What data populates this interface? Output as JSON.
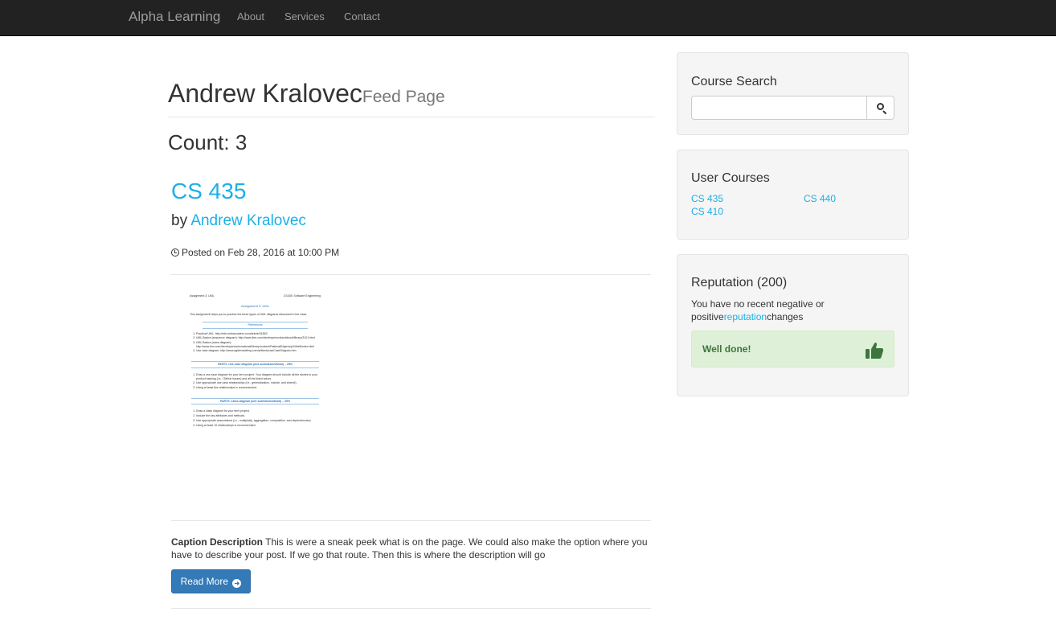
{
  "navbar": {
    "brand": "Alpha Learning",
    "links": [
      "About",
      "Services",
      "Contact"
    ]
  },
  "page": {
    "title": "Andrew Kralovec",
    "subtitle": "Feed Page",
    "count_label": "Count: 3"
  },
  "post": {
    "title": "CS 435",
    "by_label": "by",
    "author": "Andrew Kralovec",
    "posted": "Posted on Feb 28, 2016 at 10:00 PM",
    "caption_label": "Caption Description",
    "caption_text": "This is were a sneak peek what is on the page. We could also make the option where you have to describe your post. If we go that route. Then this is where the description will go",
    "read_more": "Read More"
  },
  "document": {
    "header_left": "Assignment 3: UML",
    "header_right": "CS435: Software Engineering",
    "title": "Assignment 3: UML",
    "intro": "This assignment helps you to practice the three types of UML diagrams discussed in the class.",
    "references_heading": "References",
    "references": [
      "Practical UML: http://edn.embarcadero.com/article/31863",
      "UML Basics (sequence diagram): http://www.ibm.com/developerworks/rational/library/3101.html",
      "UML Basics (class diagram): http://www.ibm.com/developerworks/rational/library/content/RationalEdge/sep04/bell/index.html",
      "Use case diagram: http://www.agilemodeling.com/artifacts/useCaseDiagram.htm"
    ],
    "part1_heading": "PART1: Use case diagram (one submission/team) – 25%",
    "part1_items": [
      "Draw a use case diagram for your term project. Your diagram should include all the stories in your product backlog (i.e., GitHub issues) and all the listed actors.",
      "Use appropriate use case relationships (i.e., generalization, include, and extend).",
      "Using at least five relationships is recommended."
    ],
    "part2_heading": "PART2: Class diagram (one submission/team) – 25%",
    "part2_items": [
      "Draw a class diagram for your term project.",
      "Include the key attributes and methods.",
      "Use appropriate associations (i.e., multiplicity, aggregation, composition, and dependencies).",
      "Using at least 10 relationships is recommended."
    ]
  },
  "sidebar": {
    "search": {
      "heading": "Course Search",
      "placeholder": ""
    },
    "courses": {
      "heading": "User Courses",
      "items": [
        "CS 435",
        "CS 440",
        "CS 410"
      ]
    },
    "reputation": {
      "heading": "Reputation (200)",
      "text_before": "You have no recent negative or positive",
      "link": "reputation",
      "text_after": "changes",
      "alert": "Well done!"
    }
  },
  "colors": {
    "link": "#1ab0e8",
    "primary_button": "#337ab7",
    "success_bg": "#dff0d8",
    "success_text": "#3c763d",
    "navbar": "#222222"
  }
}
